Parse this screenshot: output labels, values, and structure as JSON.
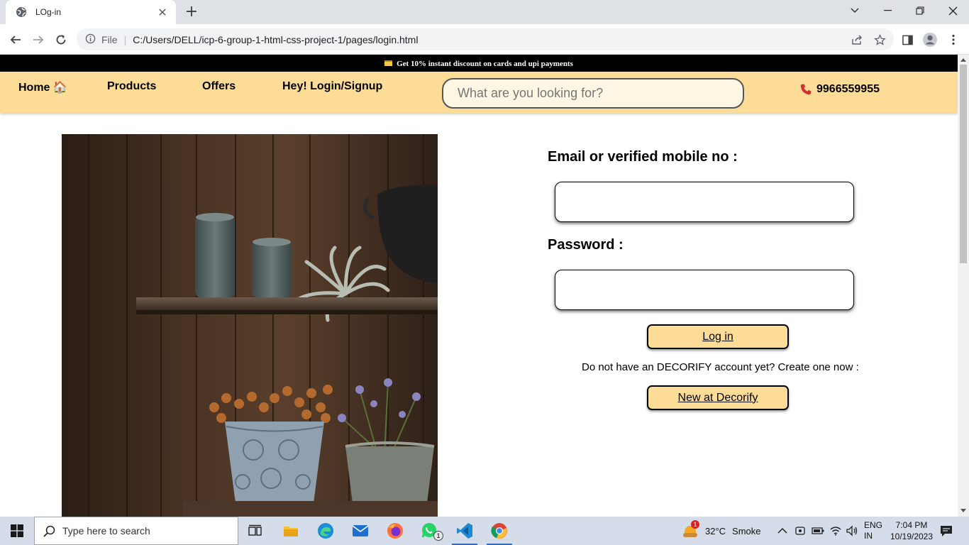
{
  "browser": {
    "tab_title": "LOg-in",
    "address_file_label": "File",
    "url": "C:/Users/DELL/icp-6-group-1-html-css-project-1/pages/login.html"
  },
  "page": {
    "promo_text": "Get 10% instant discount on cards and upi payments",
    "nav": {
      "home": "Home 🏠",
      "products": "Products",
      "offers": "Offers",
      "login_signup": "Hey! Login/Signup"
    },
    "search_placeholder": "What are you looking for?",
    "phone": "9966559955",
    "form": {
      "email_label": "Email or verified mobile no :",
      "password_label": "Password :",
      "login_button": "Log in",
      "signup_prompt": "Do not have an DECORIFY account yet? Create one now :",
      "signup_button": "New at Decorify"
    }
  },
  "taskbar": {
    "search_placeholder": "Type here to search",
    "weather_temp": "32°C",
    "weather_condition": "Smoke",
    "weather_badge": "1",
    "whatsapp_badge": "1",
    "lang_top": "ENG",
    "lang_bottom": "IN",
    "time": "7:04 PM",
    "date": "10/19/2023"
  },
  "colors": {
    "nav_bg": "#fddc98",
    "promo_bg": "#000000",
    "button_bg": "#fddc98"
  }
}
